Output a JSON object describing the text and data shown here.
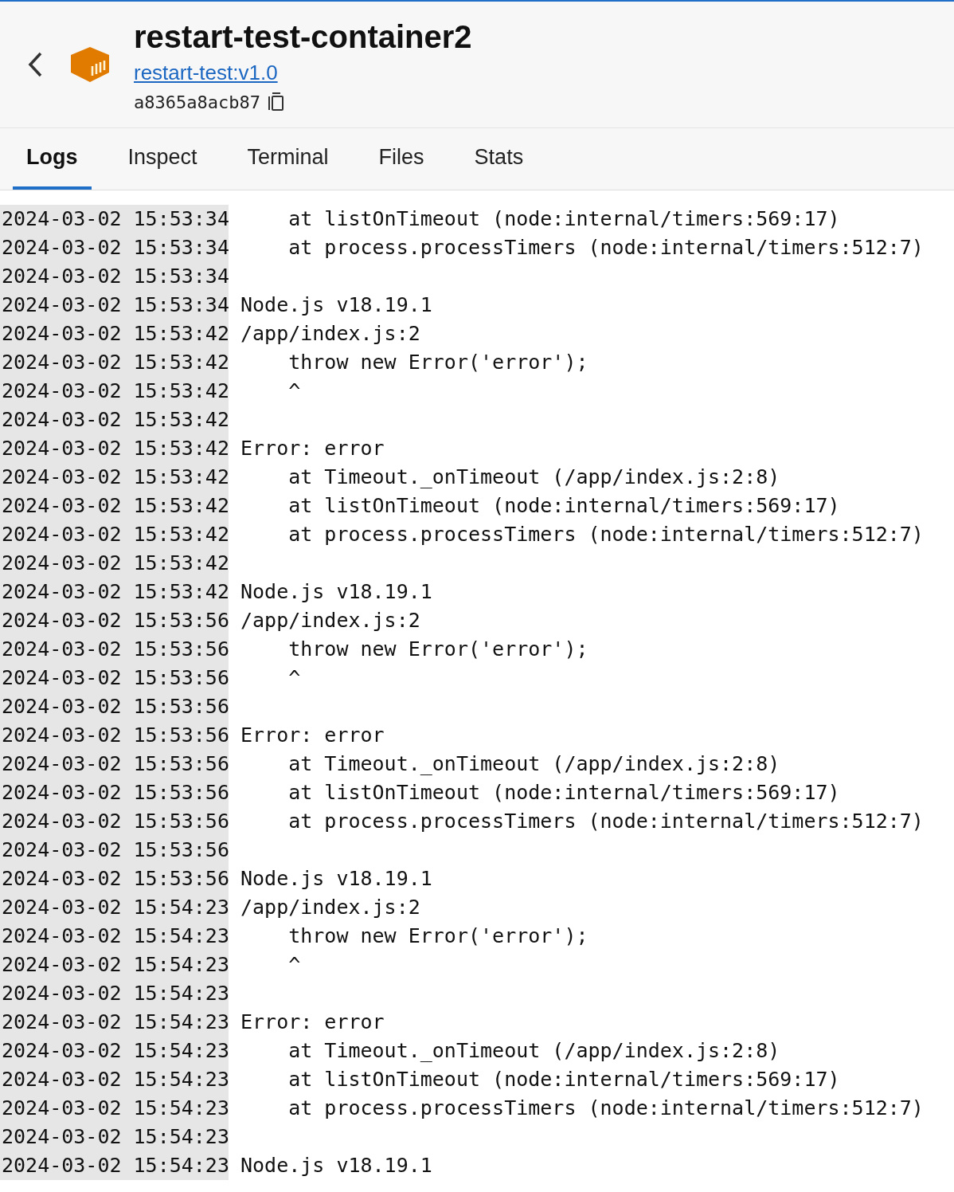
{
  "header": {
    "title": "restart-test-container2",
    "image_link": "restart-test:v1.0",
    "container_id": "a8365a8acb87"
  },
  "tabs": [
    {
      "label": "Logs",
      "selected": true
    },
    {
      "label": "Inspect",
      "selected": false
    },
    {
      "label": "Terminal",
      "selected": false
    },
    {
      "label": "Files",
      "selected": false
    },
    {
      "label": "Stats",
      "selected": false
    }
  ],
  "log_lines": [
    {
      "timestamp": "2024-03-02 15:53:34",
      "message": "    at listOnTimeout (node:internal/timers:569:17)"
    },
    {
      "timestamp": "2024-03-02 15:53:34",
      "message": "    at process.processTimers (node:internal/timers:512:7)"
    },
    {
      "timestamp": "2024-03-02 15:53:34"
    },
    {
      "timestamp": "2024-03-02 15:53:34",
      "message": "Node.js v18.19.1"
    },
    {
      "timestamp": "2024-03-02 15:53:42",
      "message": "/app/index.js:2"
    },
    {
      "timestamp": "2024-03-02 15:53:42",
      "message": "    throw new Error('error');"
    },
    {
      "timestamp": "2024-03-02 15:53:42",
      "message": "    ^"
    },
    {
      "timestamp": "2024-03-02 15:53:42"
    },
    {
      "timestamp": "2024-03-02 15:53:42",
      "message": "Error: error"
    },
    {
      "timestamp": "2024-03-02 15:53:42",
      "message": "    at Timeout._onTimeout (/app/index.js:2:8)"
    },
    {
      "timestamp": "2024-03-02 15:53:42",
      "message": "    at listOnTimeout (node:internal/timers:569:17)"
    },
    {
      "timestamp": "2024-03-02 15:53:42",
      "message": "    at process.processTimers (node:internal/timers:512:7)"
    },
    {
      "timestamp": "2024-03-02 15:53:42"
    },
    {
      "timestamp": "2024-03-02 15:53:42",
      "message": "Node.js v18.19.1"
    },
    {
      "timestamp": "2024-03-02 15:53:56",
      "message": "/app/index.js:2"
    },
    {
      "timestamp": "2024-03-02 15:53:56",
      "message": "    throw new Error('error');"
    },
    {
      "timestamp": "2024-03-02 15:53:56",
      "message": "    ^"
    },
    {
      "timestamp": "2024-03-02 15:53:56"
    },
    {
      "timestamp": "2024-03-02 15:53:56",
      "message": "Error: error"
    },
    {
      "timestamp": "2024-03-02 15:53:56",
      "message": "    at Timeout._onTimeout (/app/index.js:2:8)"
    },
    {
      "timestamp": "2024-03-02 15:53:56",
      "message": "    at listOnTimeout (node:internal/timers:569:17)"
    },
    {
      "timestamp": "2024-03-02 15:53:56",
      "message": "    at process.processTimers (node:internal/timers:512:7)"
    },
    {
      "timestamp": "2024-03-02 15:53:56"
    },
    {
      "timestamp": "2024-03-02 15:53:56",
      "message": "Node.js v18.19.1"
    },
    {
      "timestamp": "2024-03-02 15:54:23",
      "message": "/app/index.js:2"
    },
    {
      "timestamp": "2024-03-02 15:54:23",
      "message": "    throw new Error('error');"
    },
    {
      "timestamp": "2024-03-02 15:54:23",
      "message": "    ^"
    },
    {
      "timestamp": "2024-03-02 15:54:23"
    },
    {
      "timestamp": "2024-03-02 15:54:23",
      "message": "Error: error"
    },
    {
      "timestamp": "2024-03-02 15:54:23",
      "message": "    at Timeout._onTimeout (/app/index.js:2:8)"
    },
    {
      "timestamp": "2024-03-02 15:54:23",
      "message": "    at listOnTimeout (node:internal/timers:569:17)"
    },
    {
      "timestamp": "2024-03-02 15:54:23",
      "message": "    at process.processTimers (node:internal/timers:512:7)"
    },
    {
      "timestamp": "2024-03-02 15:54:23"
    },
    {
      "timestamp": "2024-03-02 15:54:23",
      "message": "Node.js v18.19.1"
    }
  ]
}
